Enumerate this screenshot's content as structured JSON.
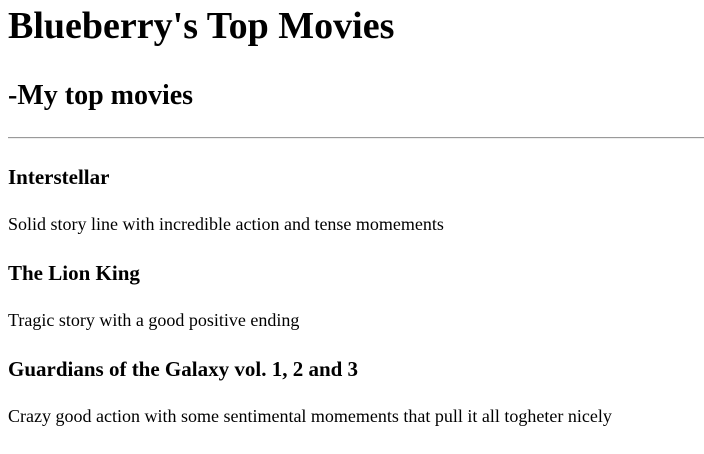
{
  "page": {
    "title": "Blueberry's Top Movies",
    "subtitle": "-My top movies"
  },
  "movies": [
    {
      "title": "Interstellar",
      "description": "Solid story line with incredible action and tense momements"
    },
    {
      "title": "The Lion King",
      "description": "Tragic story with a good positive ending"
    },
    {
      "title": "Guardians of the Galaxy vol. 1, 2 and 3",
      "description": "Crazy good action with some sentimental momements that pull it all togheter nicely"
    }
  ]
}
